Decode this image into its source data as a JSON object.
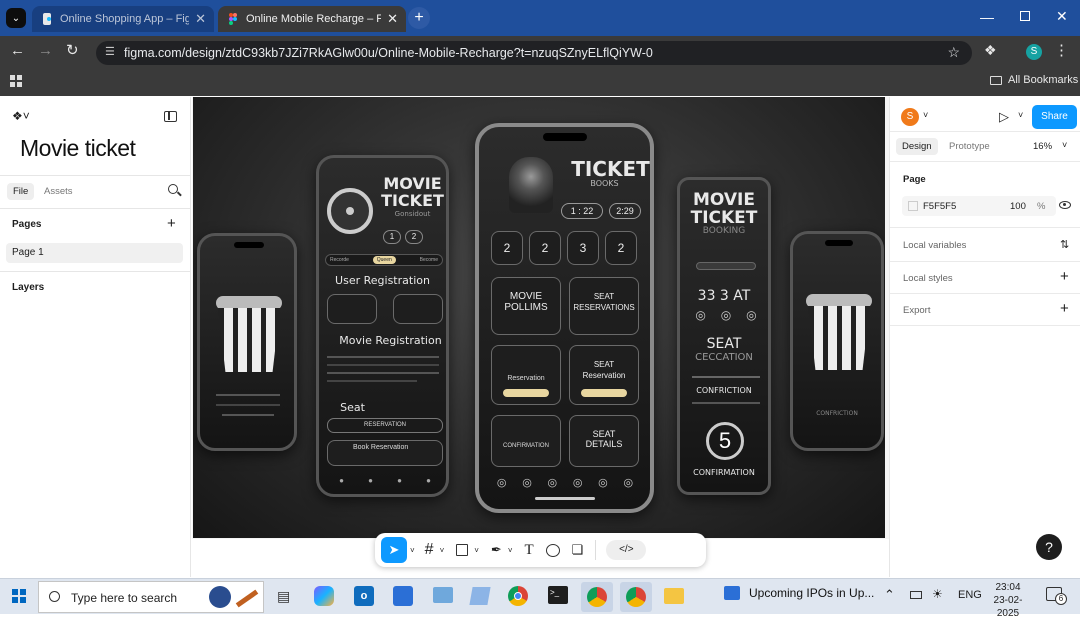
{
  "browser": {
    "tabs": [
      {
        "title": "Online Shopping App – Figma",
        "active": false
      },
      {
        "title": "Online Mobile Recharge – Figm",
        "active": true
      }
    ],
    "url": "figma.com/design/ztdC93kb7JZi7RkAGlw00u/Online-Mobile-Recharge?t=nzuqSZnyELflQiYW-0",
    "bookmarks_label": "All Bookmarks",
    "profile_initial": "S"
  },
  "figma": {
    "file_name": "Movie ticket",
    "left_tabs": [
      "File",
      "Assets"
    ],
    "pages_heading": "Pages",
    "pages": [
      "Page 1"
    ],
    "layers_heading": "Layers",
    "avatar_initial": "S",
    "share_label": "Share",
    "right_tabs": [
      "Design",
      "Prototype"
    ],
    "zoom": "16%",
    "page_section": "Page",
    "page_color": "F5F5F5",
    "page_opacity": "100",
    "page_opacity_unit": "%",
    "local_variables": "Local variables",
    "local_styles": "Local styles",
    "export": "Export",
    "help": "?"
  },
  "artwork": {
    "left_phone": {
      "title1": "MOVIE",
      "title2": "TICKET",
      "sub": "Gonsidout",
      "nums": [
        "1",
        "2"
      ],
      "tabs": [
        "Recorde",
        "Queen",
        "Become"
      ],
      "section1": "User Registration",
      "section2": "Movie Registration",
      "section3": "Seat",
      "bar_text": "RESERVATION",
      "item_text": "Book Reservation"
    },
    "center_phone": {
      "title": "TICKET",
      "subtitle": "BOOKS",
      "chip1": "1 : 22",
      "chip2": "2:29",
      "tiles": [
        "2",
        "2",
        "3",
        "2"
      ],
      "card1": "MOVIE\nPOLLIMS",
      "card2": "SEAT\nRESERVATIONS",
      "card3": "Reservation",
      "card4": "SEAT\nReservation",
      "card5": "CONFIRMATION",
      "card6": "SEAT\nDETAILS"
    },
    "right_phone": {
      "title1": "MOVIE",
      "title2": "TICKET",
      "sub": "BOOKING",
      "nums": "33  3 AT",
      "seat": "SEAT",
      "seat2": "CECCATION",
      "confirm1": "CONFRICTION",
      "big_num": "5",
      "confirm2": "CONFIRMATION"
    },
    "far_right_caption": "CONFRICTION"
  },
  "taskbar": {
    "search_placeholder": "Type here to search",
    "news": "Upcoming IPOs in Up...",
    "lang": "ENG",
    "time": "23:04",
    "date": "23-02-2025",
    "notif_count": "6"
  }
}
